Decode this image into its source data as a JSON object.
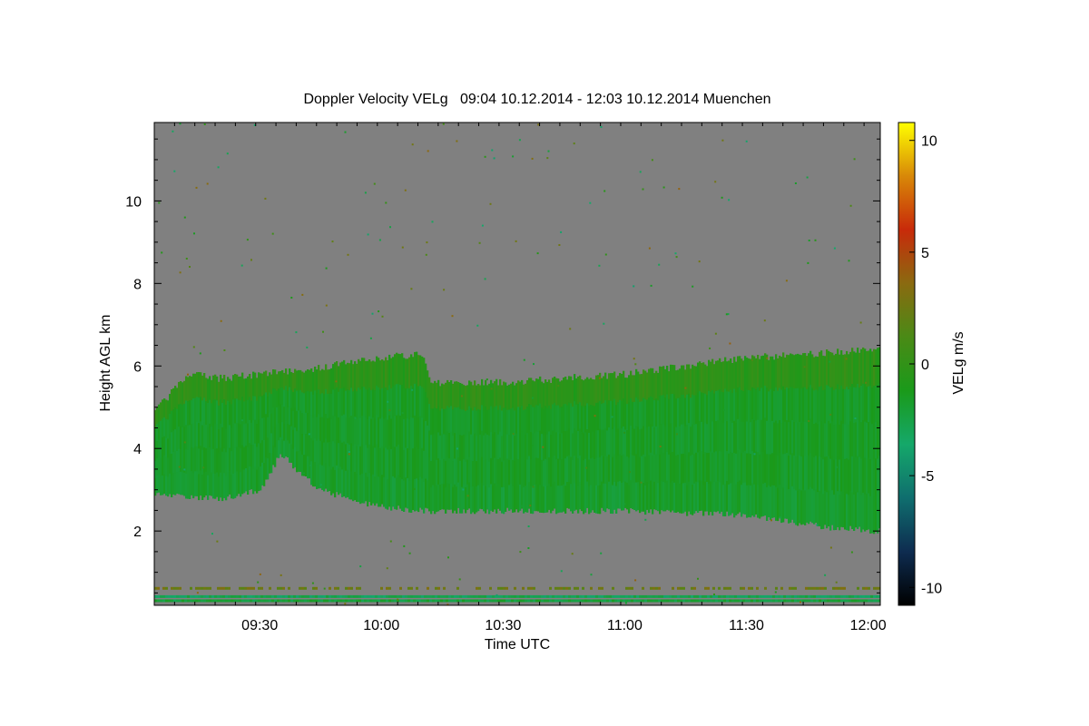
{
  "chart_data": {
    "type": "heatmap",
    "title": "Doppler Velocity VELg   09:04 10.12.2014 - 12:03 10.12.2014 Muenchen",
    "xlabel": "Time UTC",
    "ylabel": "Height AGL km",
    "x_range_utc": [
      "09:04",
      "12:03"
    ],
    "x_ticks": [
      "09:30",
      "10:00",
      "10:30",
      "11:00",
      "11:30",
      "12:00"
    ],
    "y_range_km": [
      0.2,
      11.9
    ],
    "y_ticks": [
      2,
      4,
      6,
      8,
      10
    ],
    "colorbar": {
      "label": "VELg m/s",
      "range": [
        -10.8,
        10.8
      ],
      "ticks": [
        10,
        5,
        0,
        -5,
        -10
      ],
      "colors": [
        "#000000",
        "#0e2c50",
        "#0f6e6e",
        "#15a86a",
        "#1a9a1a",
        "#4a8a16",
        "#8a6a10",
        "#c82a0a",
        "#d88808",
        "#ffff00"
      ]
    },
    "background_color": "#808080",
    "cloud_layer": {
      "description": "mostly -1 to -2 m/s (green)",
      "top_km": [
        [
          "09:04",
          4.9
        ],
        [
          "09:12",
          5.8
        ],
        [
          "09:20",
          5.7
        ],
        [
          "09:40",
          5.9
        ],
        [
          "10:00",
          6.2
        ],
        [
          "10:10",
          6.3
        ],
        [
          "10:12",
          5.6
        ],
        [
          "10:30",
          5.6
        ],
        [
          "11:00",
          5.8
        ],
        [
          "11:30",
          6.2
        ],
        [
          "12:03",
          6.4
        ]
      ],
      "base_km": [
        [
          "09:04",
          2.9
        ],
        [
          "09:20",
          2.8
        ],
        [
          "09:30",
          3.0
        ],
        [
          "09:35",
          3.9
        ],
        [
          "09:40",
          3.4
        ],
        [
          "09:45",
          3.0
        ],
        [
          "09:55",
          2.7
        ],
        [
          "10:00",
          2.6
        ],
        [
          "10:10",
          2.5
        ],
        [
          "10:30",
          2.5
        ],
        [
          "11:00",
          2.5
        ],
        [
          "11:30",
          2.4
        ],
        [
          "11:50",
          2.1
        ],
        [
          "12:03",
          2.0
        ]
      ]
    },
    "near_ground_bands_km": [
      0.3,
      0.4,
      0.6
    ]
  }
}
